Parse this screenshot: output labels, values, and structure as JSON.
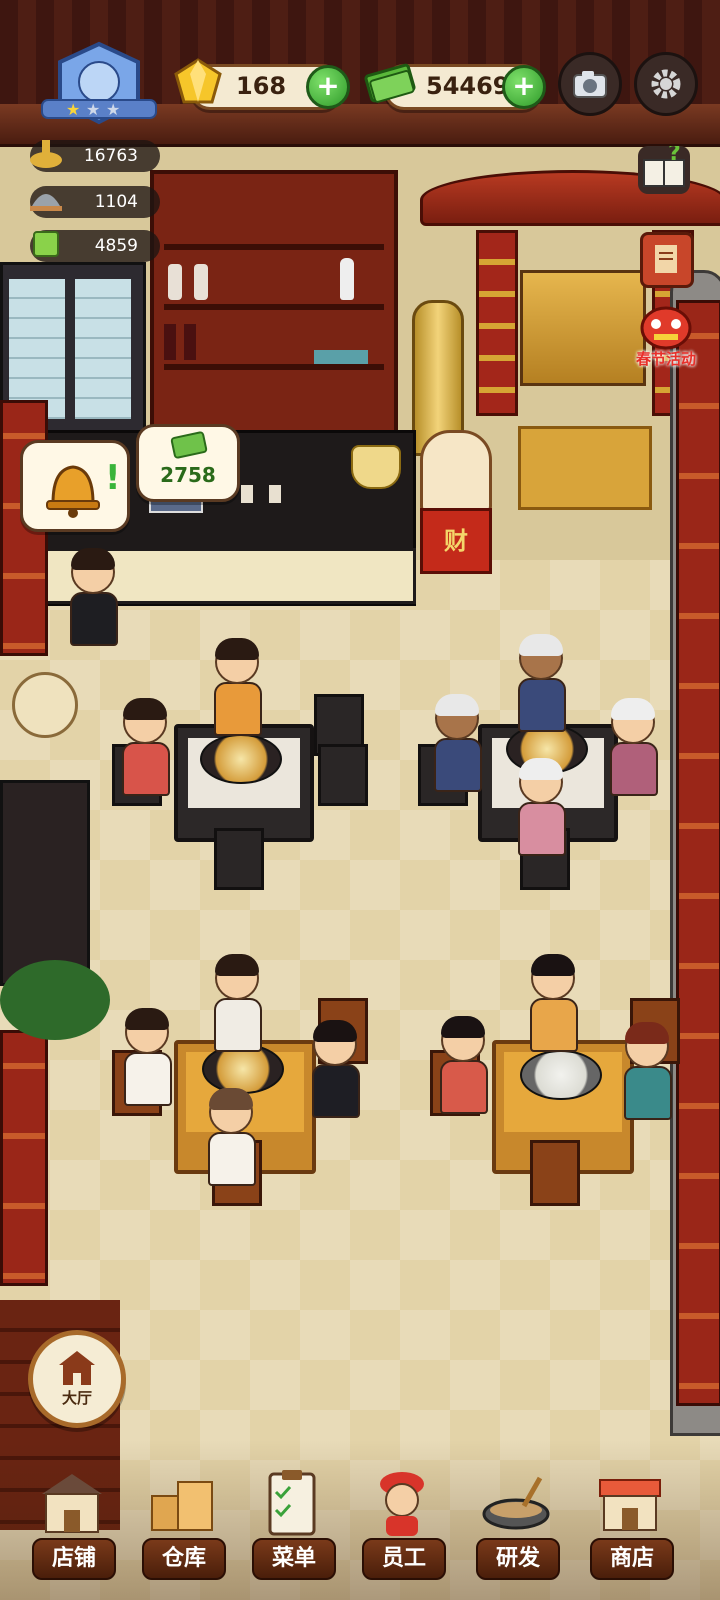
{
  "hud": {
    "gems": "168",
    "cash": "54469",
    "plus": "+"
  },
  "stats": [
    {
      "icon": "hotpot-icon",
      "value": "16763"
    },
    {
      "icon": "cloche-icon",
      "value": "1104"
    },
    {
      "icon": "dish-icon",
      "value": "4859"
    }
  ],
  "event": {
    "label": "春节活动"
  },
  "bubbles": {
    "cash_amount": "2758"
  },
  "lucky_cat": {
    "sign": "财"
  },
  "hall_button": {
    "label": "大厅"
  },
  "nav": [
    {
      "label": "店铺",
      "icon": "shop-building-icon"
    },
    {
      "label": "仓库",
      "icon": "warehouse-boxes-icon"
    },
    {
      "label": "菜单",
      "icon": "clipboard-menu-icon"
    },
    {
      "label": "员工",
      "icon": "staff-chef-icon"
    },
    {
      "label": "研发",
      "icon": "wok-research-icon"
    },
    {
      "label": "商店",
      "icon": "store-front-icon"
    }
  ],
  "colors": {
    "wall": "#d8c89a",
    "floor": "#e3d3a8",
    "accent_green": "#2f9b2a",
    "nav_brown": "#4a1e0a"
  }
}
